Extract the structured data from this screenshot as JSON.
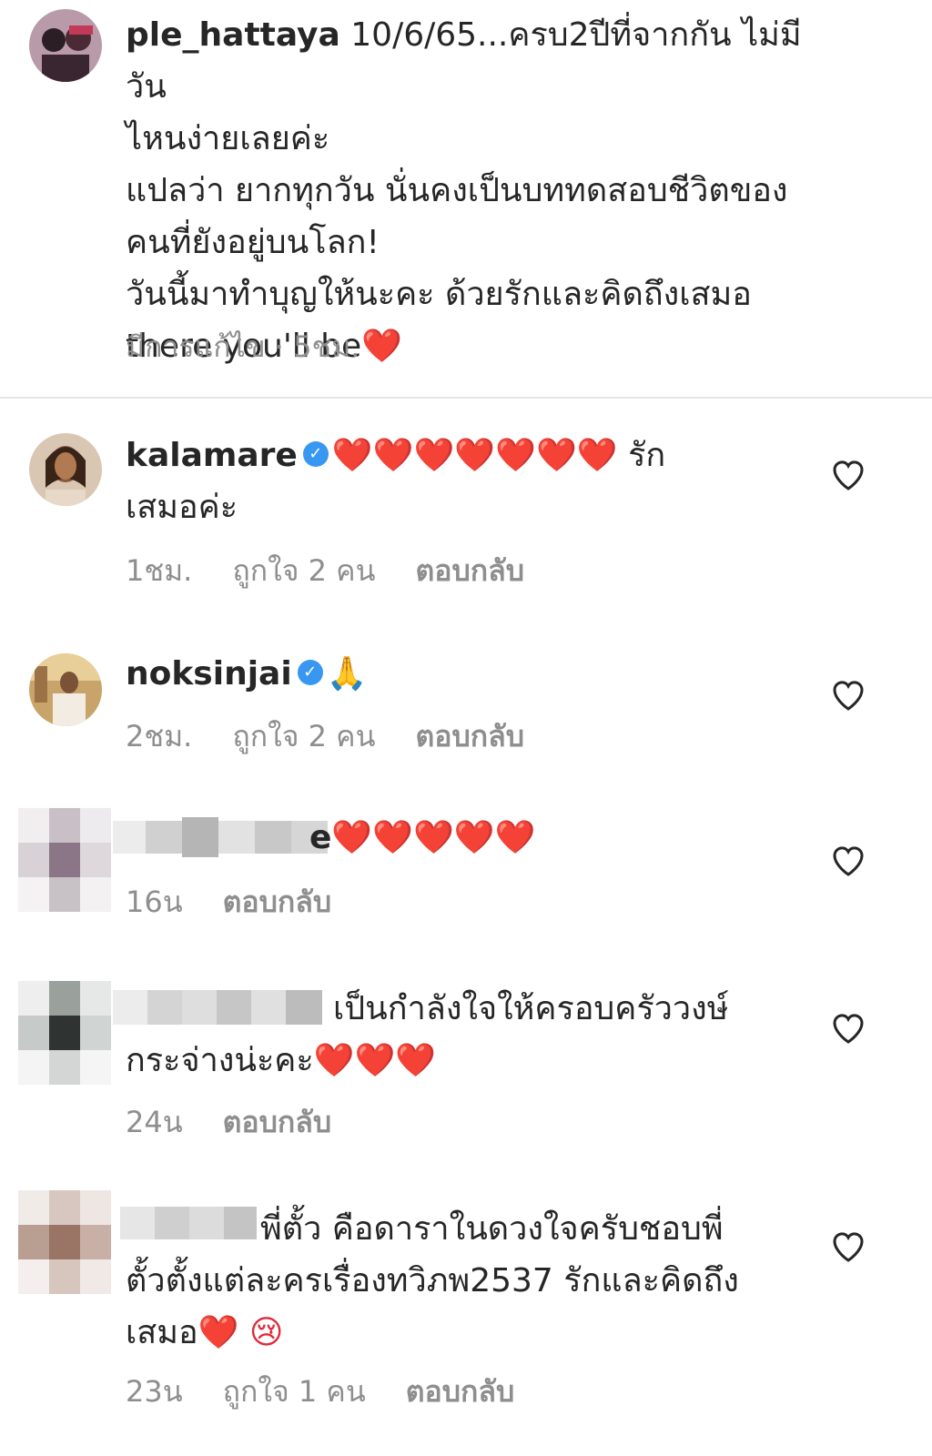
{
  "caption": {
    "username": "ple_hattaya",
    "text_line1": " 10/6/65...ครบ2ปีที่จากกัน ไม่มีวัน",
    "text_line2": "ไหนง่ายเลยค่ะ",
    "text_line3": "แปลว่า ยากทุกวัน นั่นคงเป็นบททดสอบชีวิตของ",
    "text_line4": "คนที่ยังอยู่บนโลก!",
    "text_line5": "วันนี้มาทำบุญให้นะคะ ด้วยรักและคิดถึงเสมอ",
    "text_line6": "there you'll be",
    "heart": "❤️",
    "meta": "มีการแก้ไข · 5ชม."
  },
  "comments": [
    {
      "username": "kalamare",
      "verified": true,
      "body_hearts": "❤️❤️❤️❤️❤️❤️❤️",
      "body_text": " รัก",
      "body_line2": "เสมอค่ะ",
      "time": "1ชม.",
      "likes": "ถูกใจ 2 คน",
      "reply": "ตอบกลับ"
    },
    {
      "username": "noksinjai",
      "verified": true,
      "body": "🙏",
      "time": "2ชม.",
      "likes": "ถูกใจ 2 คน",
      "reply": "ตอบกลับ"
    },
    {
      "username": "e",
      "body": "❤️❤️❤️❤️❤️",
      "time": "16น",
      "reply": "ตอบกลับ"
    },
    {
      "body_line1": "เป็นกำลังใจให้ครอบครัววงษ์",
      "body_line2_text": "กระจ่างน่ะคะ",
      "body_line2_hearts": "❤️❤️❤️",
      "time": "24น",
      "reply": "ตอบกลับ"
    },
    {
      "body_line1": "พี่ตั้ว คือดาราในดวงใจครับชอบพี่",
      "body_line2": "ตั้วตั้งแต่ละครเรื่องทวิภพ2537 รักและคิดถึง",
      "body_line3_text": "เสมอ",
      "body_line3_emoji": "❤️ 😢",
      "time": "23น",
      "likes": "ถูกใจ 1 คน",
      "reply": "ตอบกลับ"
    }
  ],
  "icons": {
    "like": "heart-outline-icon",
    "verified": "verified-badge-icon"
  },
  "colors": {
    "text": "#262626",
    "meta": "#8e8e8e",
    "verified": "#3897f0",
    "heart": "#e02a3b"
  }
}
